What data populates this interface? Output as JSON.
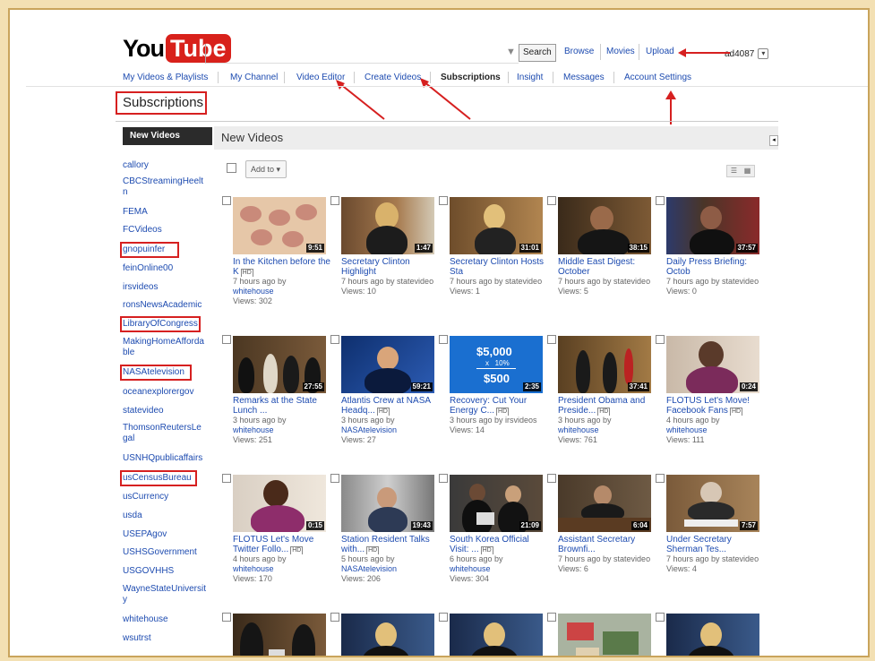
{
  "header": {
    "logo_you": "You",
    "logo_tube": "Tube",
    "search_button": "Search",
    "links": [
      "Browse",
      "Movies",
      "Upload"
    ],
    "username": "ad4087"
  },
  "nav": {
    "items": [
      "My Videos & Playlists",
      "My Channel",
      "Video Editor",
      "Create Videos",
      "Subscriptions",
      "Insight",
      "Messages",
      "Account Settings"
    ],
    "active": "Subscriptions"
  },
  "page_title": "Subscriptions",
  "sidebar": {
    "header": "New Videos",
    "items": [
      "callory",
      "CBCStreamingHeelt n",
      "FEMA",
      "FCVideos",
      "gnopuinfer",
      "feinOnline00",
      "irsvideos",
      "ronsNewsAcademic",
      "LibraryOfCongress",
      "MakingHomeAfforda ble",
      "NASAtelevision",
      "oceanexplorergov",
      "statevideo",
      "ThomsonReutersLe gal",
      "USNHQpublicaffairs",
      "usCensusBureau",
      "usCurrency",
      "usda",
      "USEPAgov",
      "USHSGovernment",
      "USGOVHHS",
      "WayneStateUniversit y",
      "whitehouse",
      "wsutrst"
    ]
  },
  "content": {
    "header": "New Videos",
    "add_to_label": "Add to",
    "videos": [
      {
        "title": "In the Kitchen before the K",
        "hd": "HD",
        "duration": "9:51",
        "meta": "7 hours ago by",
        "by": "whitehouse",
        "views": "Views: 302"
      },
      {
        "title": "Secretary Clinton Highlight",
        "hd": "",
        "duration": "1:47",
        "meta": "7 hours ago by statevideo",
        "by": "",
        "views": "Views: 10"
      },
      {
        "title": "Secretary Clinton Hosts Sta",
        "hd": "",
        "duration": "31:01",
        "meta": "7 hours ago by statevideo",
        "by": "",
        "views": "Views: 1"
      },
      {
        "title": "Middle East Digest: October",
        "hd": "",
        "duration": "38:15",
        "meta": "7 hours ago by statevideo",
        "by": "",
        "views": "Views: 5"
      },
      {
        "title": "Daily Press Briefing: Octob",
        "hd": "",
        "duration": "37:57",
        "meta": "7 hours ago by statevideo",
        "by": "",
        "views": "Views: 0"
      },
      {
        "title": "Remarks at the State Lunch ...",
        "hd": "",
        "duration": "27:55",
        "meta": "3 hours ago by",
        "by": "whitehouse",
        "views": "Views: 251"
      },
      {
        "title": "Atlantis Crew at NASA Headq...",
        "hd": "HD",
        "duration": "59:21",
        "meta": "3 hours ago by",
        "by": "NASAtelevision",
        "views": "Views: 27"
      },
      {
        "title": "Recovery: Cut Your Energy C...",
        "hd": "HD",
        "duration": "2:35",
        "meta": "3 hours ago by irsvideos",
        "by": "",
        "views": "Views: 14"
      },
      {
        "title": "President Obama and Preside...",
        "hd": "HD",
        "duration": "37:41",
        "meta": "3 hours ago by",
        "by": "whitehouse",
        "views": "Views: 761"
      },
      {
        "title": "FLOTUS Let's Move! Facebook Fans",
        "hd": "HD",
        "duration": "0:24",
        "meta": "4 hours ago by",
        "by": "whitehouse",
        "views": "Views: 111"
      },
      {
        "title": "FLOTUS Let's Move Twitter Follo...",
        "hd": "HD",
        "duration": "0:15",
        "meta": "4 hours ago by",
        "by": "whitehouse",
        "views": "Views: 170"
      },
      {
        "title": "Station Resident Talks with...",
        "hd": "HD",
        "duration": "19:43",
        "meta": "5 hours ago by",
        "by": "NASAtelevision",
        "views": "Views: 206"
      },
      {
        "title": "South Korea Official Visit: ...",
        "hd": "HD",
        "duration": "21:09",
        "meta": "6 hours ago by",
        "by": "whitehouse",
        "views": "Views: 304"
      },
      {
        "title": "Assistant Secretary Brownfi...",
        "hd": "",
        "duration": "6:04",
        "meta": "7 hours ago by statevideo",
        "by": "",
        "views": "Views: 6"
      },
      {
        "title": "Under Secretary Sherman Tes...",
        "hd": "",
        "duration": "7:57",
        "meta": "7 hours ago by statevideo",
        "by": "",
        "views": "Views: 4"
      },
      {
        "title": "",
        "hd": "",
        "duration": "",
        "meta": "",
        "by": "",
        "views": ""
      },
      {
        "title": "",
        "hd": "",
        "duration": "",
        "meta": "",
        "by": "",
        "views": ""
      },
      {
        "title": "",
        "hd": "",
        "duration": "",
        "meta": "",
        "by": "",
        "views": ""
      },
      {
        "title": "",
        "hd": "",
        "duration": "",
        "meta": "",
        "by": "",
        "views": ""
      },
      {
        "title": "",
        "hd": "",
        "duration": "",
        "meta": "",
        "by": "",
        "views": ""
      }
    ]
  },
  "colors": {
    "accent_link": "#1d4bb0",
    "annotation_red": "#d62020",
    "youtube_red": "#d8211b",
    "frame_bg": "#f3e0b3"
  },
  "icons": [
    "microphone-icon",
    "account-caret-icon",
    "collapse-icon",
    "list-view-icon",
    "grid-view-icon",
    "select-all-checkbox",
    "video-checkbox"
  ]
}
